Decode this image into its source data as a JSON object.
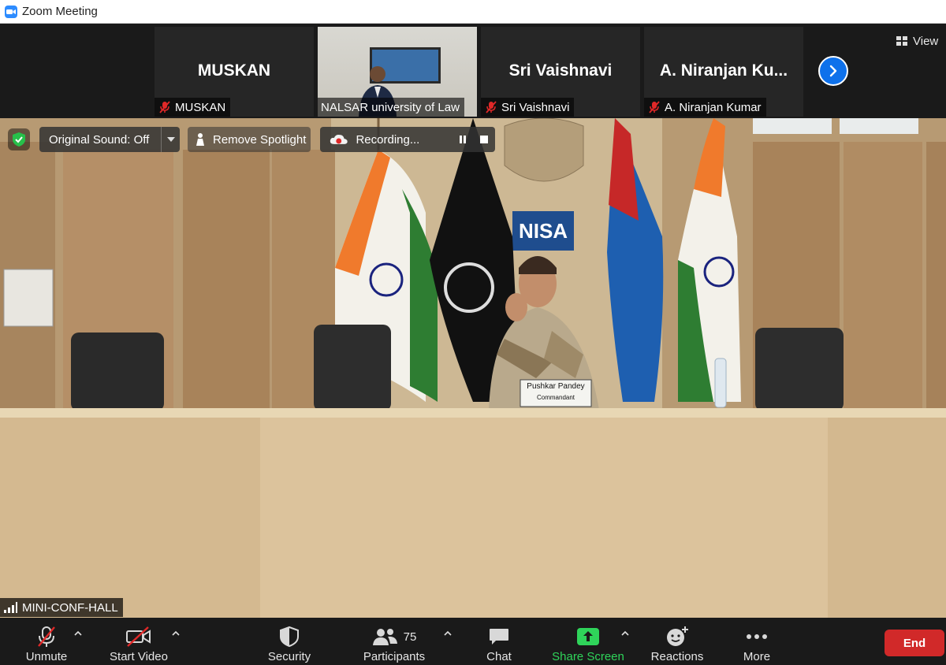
{
  "window": {
    "title": "Zoom Meeting"
  },
  "thumbnails": [
    {
      "name": "MUSKAN",
      "label": "MUSKAN",
      "muted": true,
      "video": false
    },
    {
      "name": "",
      "label": "NALSAR university of Law",
      "muted": false,
      "video": true
    },
    {
      "name": "Sri Vaishnavi",
      "label": "Sri Vaishnavi",
      "muted": true,
      "video": false
    },
    {
      "name": "A. Niranjan Ku...",
      "label": "A. Niranjan Kumar",
      "muted": true,
      "video": false
    }
  ],
  "view_button": {
    "label": "View"
  },
  "overlay": {
    "original_sound": "Original Sound: Off",
    "spotlight": "Remove Spotlight",
    "recording": "Recording..."
  },
  "scene": {
    "sign": "NISA",
    "nameplate_line1": "Pushkar Pandey",
    "nameplate_line2": "Commandant"
  },
  "main_name_tag": "MINI-CONF-HALL",
  "toolbar": {
    "unmute": "Unmute",
    "start_video": "Start Video",
    "security": "Security",
    "participants": "Participants",
    "participants_count": "75",
    "chat": "Chat",
    "share_screen": "Share Screen",
    "reactions": "Reactions",
    "more": "More",
    "end": "End"
  },
  "colors": {
    "accent_blue": "#0e71eb",
    "share_green": "#2fd45a",
    "end_red": "#d12929",
    "muted_red": "#e02828"
  }
}
